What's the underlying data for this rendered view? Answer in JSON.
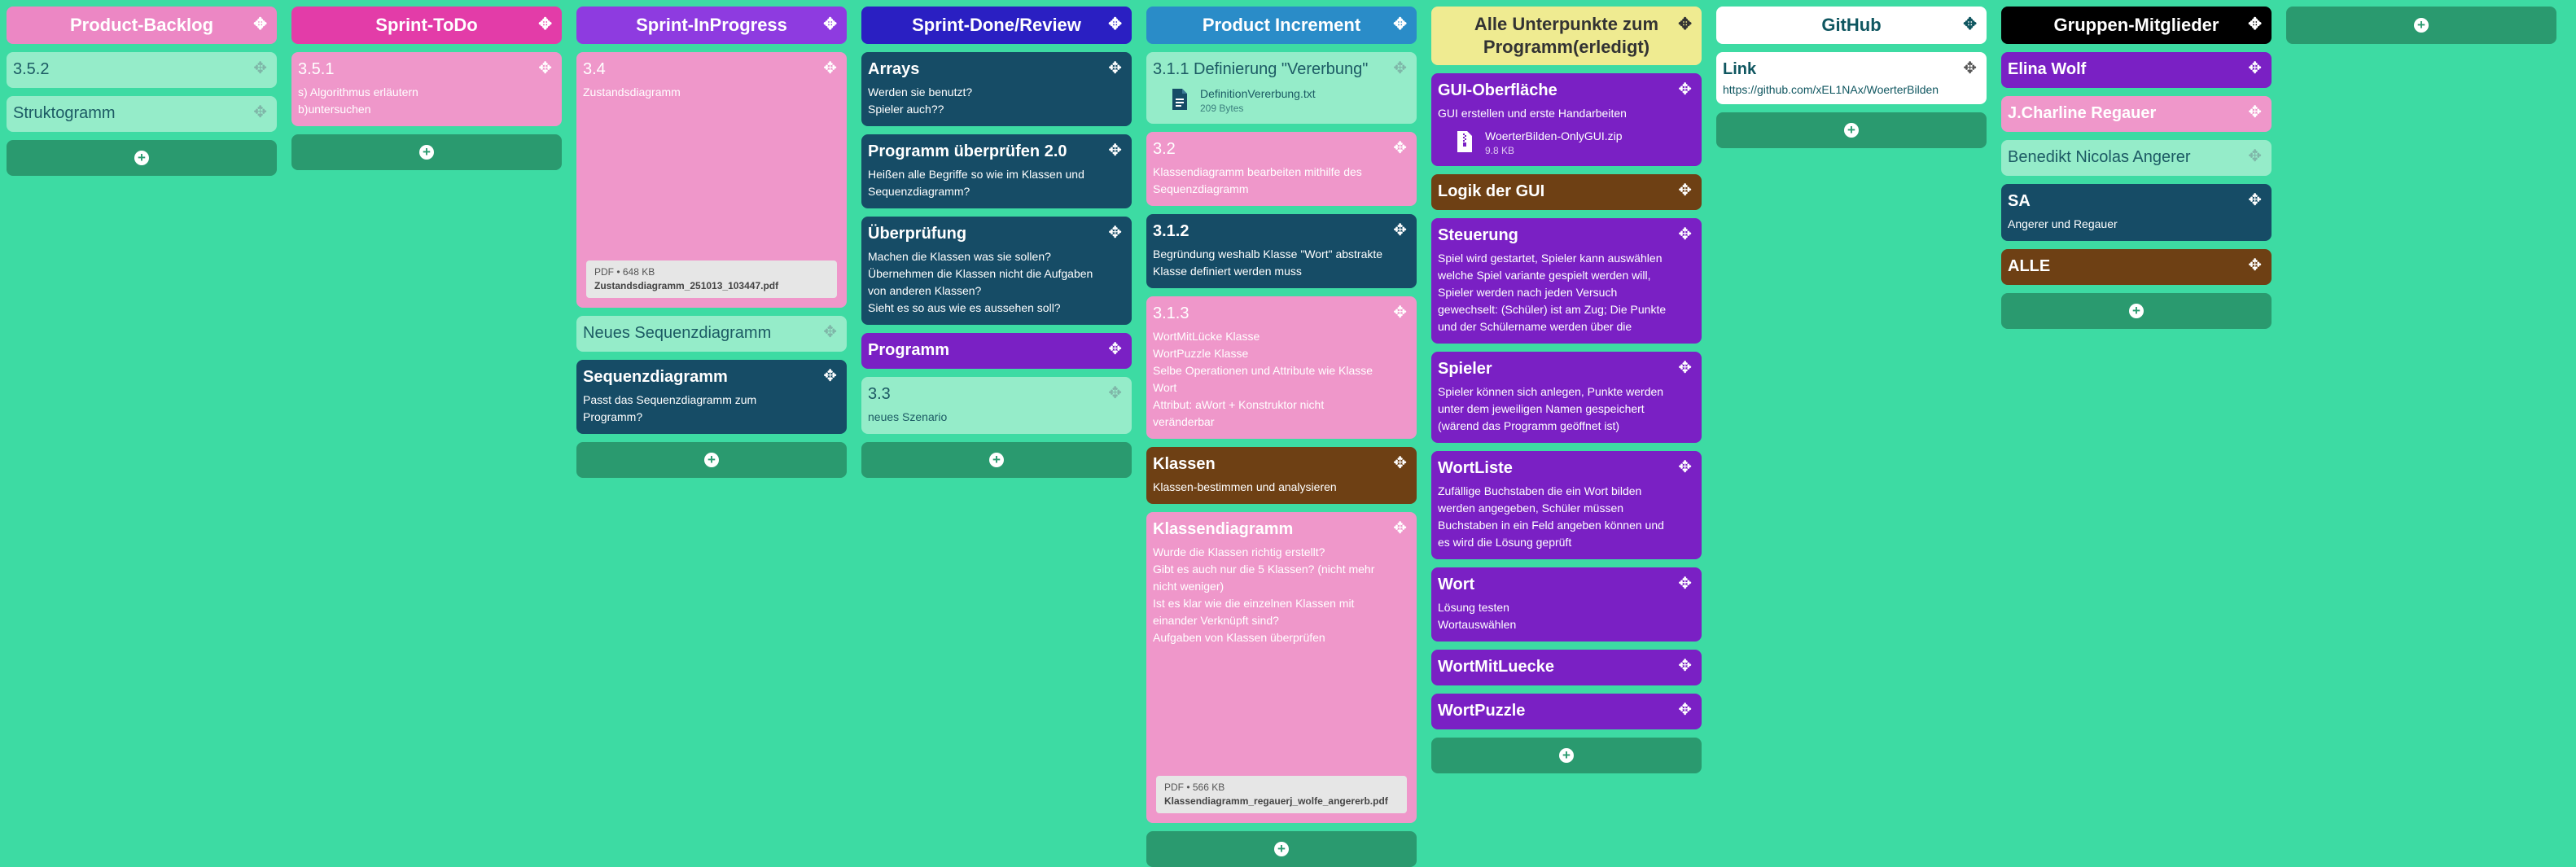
{
  "columns": [
    {
      "title": "Product-Backlog",
      "color": "#ec87c4",
      "cards": [
        {
          "title": "3.5.2",
          "style": "mint"
        },
        {
          "title": "Struktogramm",
          "style": "mint"
        }
      ]
    },
    {
      "title": "Sprint-ToDo",
      "color": "#e33ca8",
      "cards": [
        {
          "title": "3.5.1",
          "desc": "s) Algorithmus erläutern\nb)untersuchen",
          "style": "pink"
        }
      ]
    },
    {
      "title": "Sprint-InProgress",
      "color": "#8e3be0",
      "cards": [
        {
          "title": "3.4",
          "desc": "Zustandsdiagramm",
          "style": "pink",
          "pdf": {
            "meta": "PDF • 648 KB",
            "name": "Zustandsdiagramm_251013_103447.pdf"
          }
        },
        {
          "title": "Neues Sequenzdiagramm",
          "style": "mint"
        },
        {
          "title": "Sequenzdiagramm",
          "desc": "Passt das Sequenzdiagramm zum Programm?",
          "style": "navy"
        }
      ]
    },
    {
      "title": "Sprint-Done/Review",
      "color": "#2a1fc2",
      "cards": [
        {
          "title": "Arrays",
          "desc": "Werden sie benutzt?\nSpieler auch??",
          "style": "navy"
        },
        {
          "title": "Programm überprüfen 2.0",
          "desc": "Heißen alle Begriffe so wie im Klassen und Sequenzdiagramm?",
          "style": "navy"
        },
        {
          "title": "Überprüfung",
          "desc": "Machen die Klassen was sie sollen?\nÜbernehmen die Klassen nicht die Aufgaben von anderen Klassen?\nSieht es so aus wie es aussehen soll?",
          "style": "navy"
        },
        {
          "title": "Programm",
          "style": "purple"
        },
        {
          "title": "3.3",
          "desc": "neues Szenario",
          "style": "mint"
        }
      ]
    },
    {
      "title": "Product Increment",
      "color": "#2a8cc8",
      "cards": [
        {
          "title": "3.1.1 Definierung \"Vererbung\"",
          "style": "mint",
          "file": {
            "name": "DefinitionVererbung.txt",
            "size": "209 Bytes",
            "icon": "document-icon"
          }
        },
        {
          "title": "3.2",
          "desc": "Klassendiagramm bearbeiten mithilfe des Sequenzdiagramm",
          "style": "pink"
        },
        {
          "title": "3.1.2",
          "desc": "Begründung weshalb Klasse \"Wort\" abstrakte Klasse definiert werden muss",
          "style": "navy"
        },
        {
          "title": "3.1.3",
          "desc": "WortMitLücke Klasse\nWortPuzzle Klasse\nSelbe Operationen und Attribute wie Klasse Wort\nAttribut: aWort + Konstruktor nicht veränderbar",
          "style": "pink"
        },
        {
          "title": "Klassen",
          "desc": "Klassen-bestimmen und analysieren",
          "style": "brown"
        },
        {
          "title": "Klassendiagramm",
          "desc": "Wurde die Klassen richtig erstellt?\nGibt es auch nur die 5 Klassen? (nicht mehr nicht weniger)\nIst es klar wie die einzelnen Klassen mit einander Verknüpft sind?\nAufgaben von Klassen überprüfen",
          "style": "pink",
          "pdf": {
            "meta": "PDF • 566 KB",
            "name": "Klassendiagramm_regauerj_wolfe_angererb.pdf"
          }
        }
      ]
    },
    {
      "title": "Alle Unterpunkte zum Programm(erledigt)",
      "color": "#efeb91",
      "textColor": "#333333",
      "cards": [
        {
          "title": "GUI-Oberfläche",
          "desc": "GUI erstellen und erste Handarbeiten",
          "style": "purple",
          "file": {
            "name": "WoerterBilden-OnlyGUI.zip",
            "size": "9.8 KB",
            "icon": "zip-file-icon"
          }
        },
        {
          "title": "Logik der GUI",
          "style": "brown"
        },
        {
          "title": "Steuerung",
          "desc": "Spiel wird gestartet, Spieler kann auswählen welche Spiel variante gespielt werden will, Spieler werden nach jeden Versuch gewechselt: (Schüler) ist am Zug; Die Punkte und der Schülername werden über die",
          "style": "purple"
        },
        {
          "title": "Spieler",
          "desc": "Spieler können sich anlegen, Punkte werden unter dem jeweiligen Namen gespeichert (wärend das Programm geöffnet ist)",
          "style": "purple"
        },
        {
          "title": "WortListe",
          "desc": "Zufällige Buchstaben die ein Wort bilden werden angegeben, Schüler müssen Buchstaben in ein Feld angeben können und es wird die Lösung geprüft",
          "style": "purple"
        },
        {
          "title": "Wort",
          "desc": "Lösung testen\nWortauswählen",
          "style": "purple"
        },
        {
          "title": "WortMitLuecke",
          "style": "purple"
        },
        {
          "title": "WortPuzzle",
          "style": "purple"
        }
      ]
    },
    {
      "title": "GitHub",
      "color": "#ffffff",
      "textColor": "#0f5660",
      "cards": [
        {
          "title": "Link",
          "link": "https://github.com/xEL1NAx/WoerterBilden",
          "style": "white"
        }
      ]
    },
    {
      "title": "Gruppen-Mitglieder",
      "color": "#000000",
      "cards": [
        {
          "title": "Elina Wolf",
          "style": "purple"
        },
        {
          "title": "J.Charline Regauer",
          "style": "pink"
        },
        {
          "title": "Benedikt Nicolas Angerer",
          "style": "mint"
        },
        {
          "title": "SA",
          "desc": "Angerer und Regauer",
          "style": "navy"
        },
        {
          "title": "ALLE",
          "style": "brown"
        }
      ]
    }
  ],
  "icons": {
    "move": "move-handle-icon",
    "add": "add-circle-icon"
  }
}
